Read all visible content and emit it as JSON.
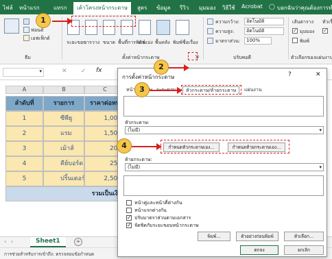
{
  "ribbon_tabs": {
    "file": "ไฟล์",
    "home": "หน้าแรก",
    "insert": "แทรก",
    "page_layout": "เค้าโครงหน้ากระดาษ",
    "formulas": "สูตร",
    "data": "ข้อมูล",
    "review": "รีวิว",
    "view": "มุมมอง",
    "help": "วิธีใช้",
    "acrobat": "Acrobat",
    "tell_me": "บอกฉันว่าคุณต้องการทำอะไร"
  },
  "ribbon": {
    "themes_fonts": "ฟอนต์",
    "themes_effects": "เอฟเฟ็กต์",
    "themes_group": "ธีม",
    "margins": "ระยะขอบ",
    "orientation": "การวาง",
    "size": "ขนาด",
    "print_area": "พื้นที่การพิมพ์",
    "breaks": "ตัวแบ่ง",
    "background": "พื้นหลัง",
    "print_titles": "พิมพ์ชื่อเรื่อง",
    "page_setup_group": "ตั้งค่าหน้ากระดาษ",
    "width_label": "ความกว้าง:",
    "width_value": "อัตโนมัติ",
    "height_label": "ความสูง:",
    "height_value": "อัตโนมัติ",
    "scale_label": "มาตราส่วน:",
    "scale_value": "100%",
    "scale_group": "ปรับพอดี",
    "gridlines": "เส้นตาราง",
    "headings": "หัวเรื่อง",
    "view_label": "มุมมอง",
    "print_label": "พิมพ์",
    "sheet_options_group": "ตัวเลือกของแผ่นงาน"
  },
  "formula_bar": {
    "fx": "fx",
    "cancel": "✕",
    "enter": "✓"
  },
  "grid": {
    "columns": [
      "A",
      "B",
      "C"
    ],
    "headers": [
      "ลำดับที่",
      "รายการ",
      "ราคาต่อหน่"
    ],
    "rows": [
      {
        "no": "1",
        "item": "ซีพียู",
        "price": "1,000."
      },
      {
        "no": "2",
        "item": "แรม",
        "price": "1,500."
      },
      {
        "no": "3",
        "item": "เม้าส์",
        "price": "200."
      },
      {
        "no": "4",
        "item": "คีย์บอร์ด",
        "price": "250."
      },
      {
        "no": "5",
        "item": "ปริ้นเตอร์",
        "price": "2,500."
      }
    ],
    "total_label": "รวมเป็นเงิน"
  },
  "sheets": {
    "active": "Sheet1",
    "add": "+"
  },
  "status": {
    "text": "การช่วยสำหรับการเข้าถึง: ตรวจสอบข้อกำหนด"
  },
  "dialog": {
    "title": "การตั้งค่าหน้ากระดาษ",
    "help": "?",
    "close": "✕",
    "tabs": [
      "หน้ากระดาษ",
      "ระยะขอบ",
      "หัวกระดาษ/ท้ายกระดาษ",
      "แผ่นงาน"
    ],
    "header_label": "หัวกระดาษ:",
    "header_value": "(ไม่มี)",
    "custom_header_btn": "กำหนดหัวกระดาษเอง...",
    "custom_footer_btn": "กำหนดท้ายกระดาษเอง...",
    "footer_label": "ท้ายกระดาษ:",
    "footer_value": "(ไม่มี)",
    "options": [
      {
        "label": "หน้าคู่และหน้าคี่ต่างกัน",
        "checked": false
      },
      {
        "label": "หน้าแรกต่างกัน",
        "checked": false
      },
      {
        "label": "ปรับมาตราส่วนตามเอกสาร",
        "checked": true
      },
      {
        "label": "จัดชิดกับระยะขอบหน้ากระดาษ",
        "checked": true
      }
    ],
    "print_btn": "พิมพ์...",
    "preview_btn": "ตัวอย่างก่อนพิมพ์",
    "options_btn": "ตัวเลือก...",
    "ok_btn": "ตกลง",
    "cancel_btn": "ยกเลิก"
  },
  "callouts": [
    "1",
    "2",
    "3",
    "4"
  ],
  "colors": {
    "ribbon_green": "#217346",
    "header_fill": "#7fa7c7",
    "data_fill": "#fbe7b0",
    "total_fill": "#c9daea",
    "callout": "#f7c64a",
    "highlight": "#d62020"
  }
}
